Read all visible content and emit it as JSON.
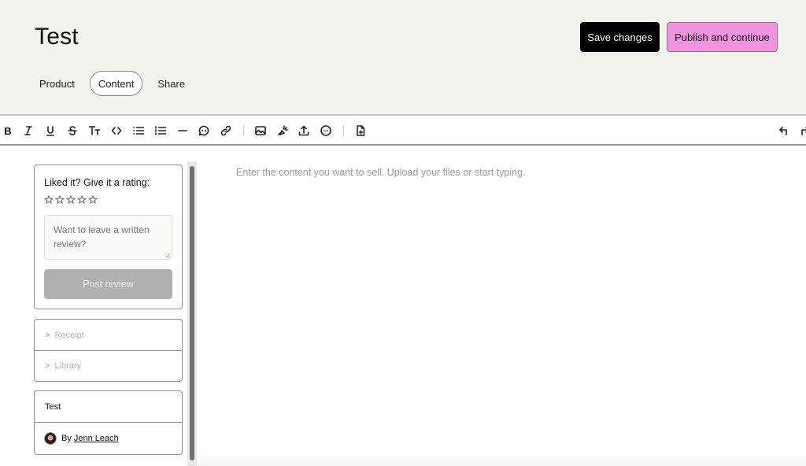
{
  "header": {
    "title": "Test",
    "save_label": "Save changes",
    "publish_label": "Publish and continue",
    "tabs": [
      {
        "label": "Product",
        "active": false
      },
      {
        "label": "Content",
        "active": true
      },
      {
        "label": "Share",
        "active": false
      }
    ]
  },
  "toolbar": {
    "items": [
      {
        "name": "bold-icon",
        "glyph": "B"
      },
      {
        "name": "italic-icon",
        "glyph": "I"
      },
      {
        "name": "underline-icon",
        "glyph": "U"
      },
      {
        "name": "strikethrough-icon",
        "glyph": "S"
      },
      {
        "name": "text-size-icon",
        "glyph": "Tт"
      },
      {
        "name": "code-icon",
        "glyph": "‹›"
      }
    ],
    "undo_icon": "undo-icon",
    "redo_icon": "redo-icon"
  },
  "sidebar": {
    "rating": {
      "title": "Liked it? Give it a rating:",
      "stars": 5,
      "value": 0,
      "review_placeholder": "Want to leave a written review?",
      "post_label": "Post review"
    },
    "nav": [
      {
        "label": "Receipt"
      },
      {
        "label": "Library"
      }
    ],
    "info": {
      "product_title": "Test",
      "by_label": "By",
      "author": "Jenn Leach"
    }
  },
  "editor": {
    "placeholder": "Enter the content you want to sell. Upload your files or start typing."
  },
  "colors": {
    "header_bg": "#f3f3ee",
    "publish_bg": "#f193df",
    "save_bg": "#000000"
  }
}
